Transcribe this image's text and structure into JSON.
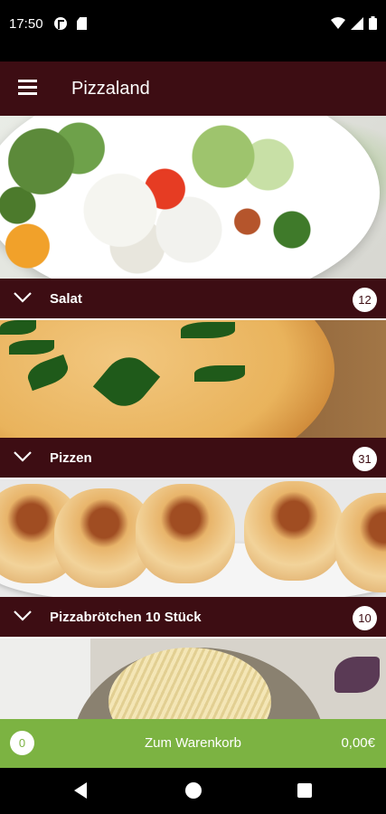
{
  "status_bar": {
    "time": "17:50",
    "icons": [
      "app-notification-icon",
      "sim-card-icon",
      "wifi-icon",
      "signal-icon",
      "battery-icon"
    ]
  },
  "app_bar": {
    "title": "Pizzaland",
    "menu_icon": "hamburger-menu-icon"
  },
  "categories": [
    {
      "label": "Salat",
      "count": "12",
      "image": "salad-photo"
    },
    {
      "label": "Pizzen",
      "count": "31",
      "image": "pizza-photo"
    },
    {
      "label": "Pizzabrötchen 10 Stück",
      "count": "10",
      "image": "pizza-rolls-photo"
    },
    {
      "label": "",
      "count": "",
      "image": "pasta-photo"
    }
  ],
  "cart": {
    "count": "0",
    "label": "Zum Warenkorb",
    "total": "0,00€"
  },
  "colors": {
    "primary": "#3d0d13",
    "cart_accent": "#7cb342"
  },
  "nav": {
    "icons": [
      "back-icon",
      "home-icon",
      "recents-icon"
    ]
  }
}
